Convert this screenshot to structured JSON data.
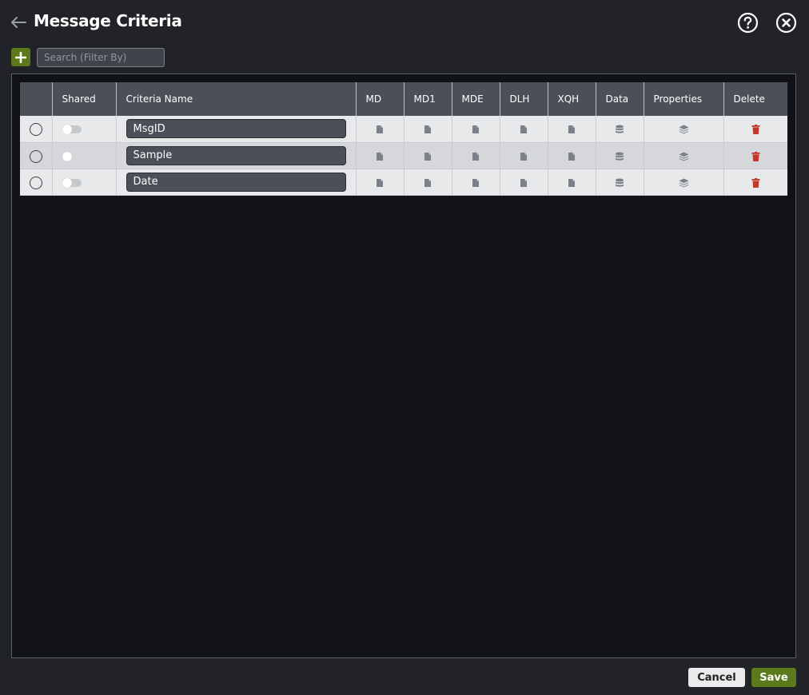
{
  "header": {
    "title": "Message Criteria"
  },
  "toolbar": {
    "search_placeholder": "Search (Filter By)"
  },
  "table": {
    "columns": [
      "",
      "Shared",
      "Criteria Name",
      "MD",
      "MD1",
      "MDE",
      "DLH",
      "XQH",
      "Data",
      "Properties",
      "Delete"
    ],
    "rows": [
      {
        "name": "MsgID",
        "shared": false
      },
      {
        "name": "Sample",
        "shared": false
      },
      {
        "name": "Date",
        "shared": false
      }
    ]
  },
  "footer": {
    "cancel_label": "Cancel",
    "save_label": "Save"
  },
  "colors": {
    "background": "#222328",
    "panel": "#111215",
    "header_row": "#4a4f58",
    "accent_green": "#5b7a1c",
    "delete_red": "#c0392b",
    "icon_gray": "#7b8089"
  }
}
